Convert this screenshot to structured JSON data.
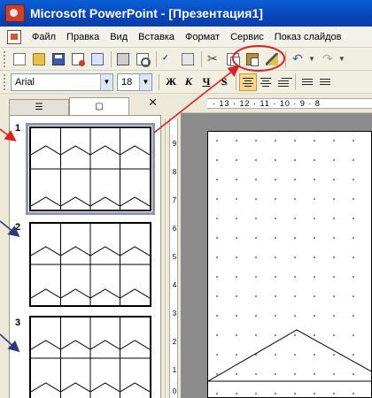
{
  "window": {
    "title": "Microsoft PowerPoint - [Презентация1]"
  },
  "menu": {
    "items": [
      "Файл",
      "Правка",
      "Вид",
      "Вставка",
      "Формат",
      "Сервис",
      "Показ слайдов"
    ]
  },
  "formatting": {
    "font": "Arial",
    "size": "18",
    "bold": "Ж",
    "italic": "К",
    "underline": "Ч",
    "shadow": "S"
  },
  "panel": {
    "close": "✕",
    "slides": [
      {
        "number": "1",
        "selected": true
      },
      {
        "number": "2",
        "selected": false
      },
      {
        "number": "3",
        "selected": false
      }
    ]
  },
  "ruler": {
    "horizontal": "· 13 · 12 · 11 · 10 · 9 · 8",
    "vertical": [
      "9",
      "8",
      "7",
      "6",
      "5",
      "4",
      "3",
      "2",
      "1",
      "0"
    ]
  },
  "annotations": {
    "arrow_color": "#e02020",
    "highlight_color": "#e02020",
    "side_arrow_color": "#2a3a7a"
  },
  "icons": [
    "new-icon",
    "open-icon",
    "save-icon",
    "permission-icon",
    "email-icon",
    "print-icon",
    "print-preview-icon",
    "spelling-icon",
    "research-icon",
    "cut-icon",
    "copy-icon",
    "paste-icon",
    "format-painter-icon",
    "undo-icon",
    "redo-icon"
  ]
}
